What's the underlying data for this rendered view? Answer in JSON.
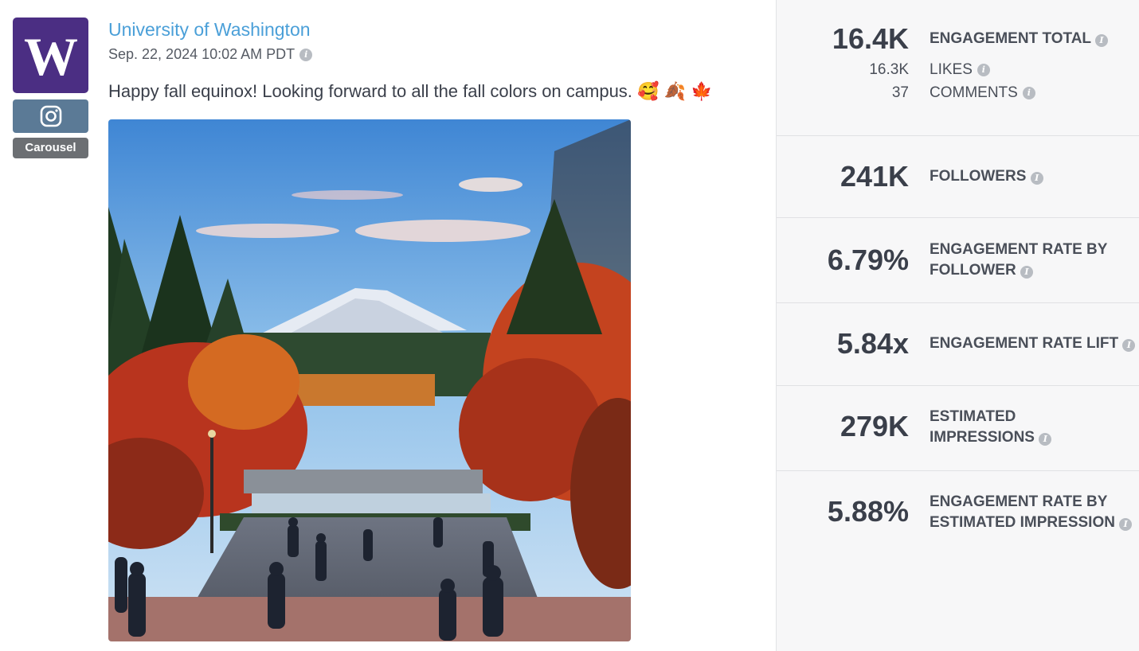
{
  "post": {
    "account_name": "University of Washington",
    "timestamp": "Sep. 22, 2024 10:02 AM PDT",
    "caption": "Happy fall equinox! Looking forward to all the fall colors on campus. 🥰 🍂 🍁",
    "platform": "instagram-icon",
    "post_type": "Carousel",
    "avatar_letter": "W",
    "brand_color": "#4b2e83"
  },
  "stats": {
    "engagement_total": {
      "value": "16.4K",
      "label": "ENGAGEMENT TOTAL"
    },
    "likes": {
      "value": "16.3K",
      "label": "LIKES"
    },
    "comments": {
      "value": "37",
      "label": "COMMENTS"
    },
    "followers": {
      "value": "241K",
      "label": "FOLLOWERS"
    },
    "engagement_rate_by_follower": {
      "value": "6.79%",
      "label": "ENGAGEMENT RATE BY FOLLOWER"
    },
    "engagement_rate_lift": {
      "value": "5.84x",
      "label": "ENGAGEMENT RATE LIFT"
    },
    "estimated_impressions": {
      "value": "279K",
      "label": "ESTIMATED IMPRESSIONS"
    },
    "engagement_rate_by_impression": {
      "value": "5.88%",
      "label": "ENGAGEMENT RATE BY ESTIMATED IMPRESSION"
    }
  }
}
